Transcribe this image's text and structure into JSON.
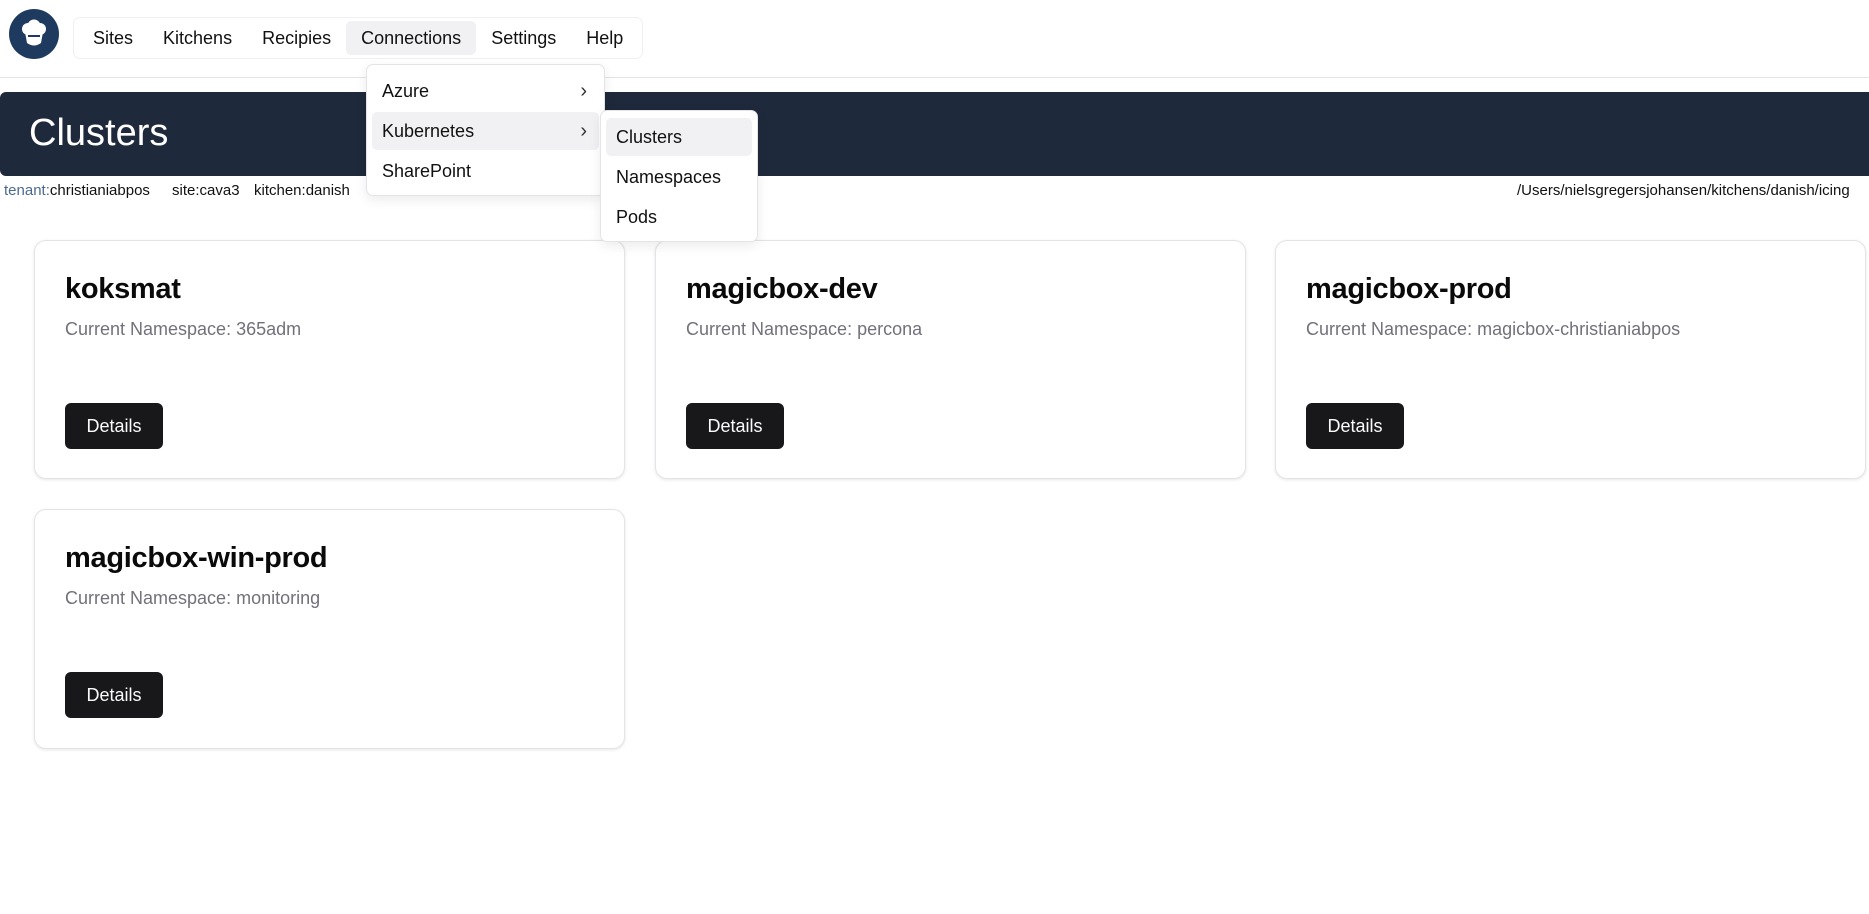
{
  "nav": {
    "logo_icon": "chef-hat-icon",
    "items": [
      "Sites",
      "Kitchens",
      "Recipies",
      "Connections",
      "Settings",
      "Help"
    ],
    "active": "Connections"
  },
  "hero": {
    "title": "Clusters"
  },
  "context": {
    "tenant_key": "tenant:",
    "tenant_value": "christianiabpos",
    "site": "site:cava3",
    "kitchen": "kitchen:danish",
    "path": "/Users/nielsgregersjohansen/kitchens/danish/icing"
  },
  "connections_menu": {
    "items": [
      {
        "label": "Azure",
        "chevron": "›"
      },
      {
        "label": "Kubernetes",
        "chevron": "›"
      },
      {
        "label": "SharePoint"
      }
    ]
  },
  "kubernetes_submenu": {
    "items": [
      "Clusters",
      "Namespaces",
      "Pods"
    ]
  },
  "clusters": [
    {
      "name": "koksmat",
      "namespace": "Current Namespace: 365adm",
      "button": "Details"
    },
    {
      "name": "magicbox-dev",
      "namespace": "Current Namespace: percona",
      "button": "Details"
    },
    {
      "name": "magicbox-prod",
      "namespace": "Current Namespace: magicbox-christianiabpos",
      "button": "Details"
    },
    {
      "name": "magicbox-win-prod",
      "namespace": "Current Namespace: monitoring",
      "button": "Details"
    }
  ],
  "colors": {
    "hero_bg": "#1e293b",
    "logo_bg": "#1f3a5f",
    "button_bg": "#18181b",
    "muted_text": "#71717a"
  }
}
